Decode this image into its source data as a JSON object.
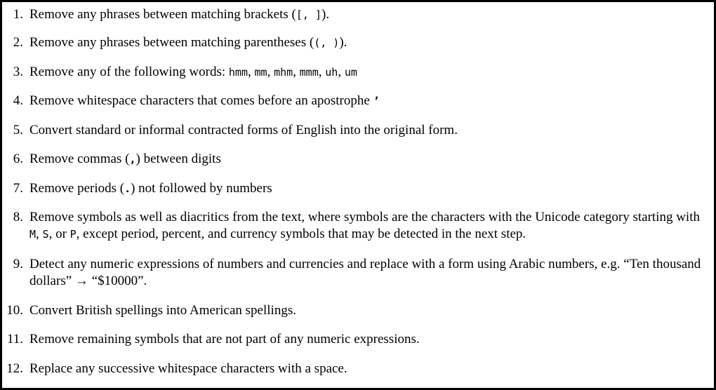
{
  "steps": [
    {
      "num": "1.",
      "segments": [
        {
          "t": "Remove any phrases between matching brackets ("
        },
        {
          "t": "[, ]",
          "mono": true
        },
        {
          "t": ")."
        }
      ]
    },
    {
      "num": "2.",
      "segments": [
        {
          "t": "Remove any phrases between matching parentheses ("
        },
        {
          "t": "(, )",
          "mono": true
        },
        {
          "t": ")."
        }
      ]
    },
    {
      "num": "3.",
      "segments": [
        {
          "t": "Remove any of the following words: "
        },
        {
          "t": "hmm",
          "mono": true
        },
        {
          "t": ", "
        },
        {
          "t": "mm",
          "mono": true
        },
        {
          "t": ", "
        },
        {
          "t": "mhm",
          "mono": true
        },
        {
          "t": ", "
        },
        {
          "t": "mmm",
          "mono": true
        },
        {
          "t": ", "
        },
        {
          "t": "uh",
          "mono": true
        },
        {
          "t": ", "
        },
        {
          "t": "um",
          "mono": true
        }
      ]
    },
    {
      "num": "4.",
      "segments": [
        {
          "t": "Remove whitespace characters that comes before an apostrophe "
        },
        {
          "t": "’",
          "mono": true,
          "bold": true
        }
      ]
    },
    {
      "num": "5.",
      "segments": [
        {
          "t": "Convert standard or informal contracted forms of English into the original form."
        }
      ]
    },
    {
      "num": "6.",
      "segments": [
        {
          "t": "Remove commas ("
        },
        {
          "t": ",",
          "mono": true,
          "bold": true
        },
        {
          "t": ") between digits"
        }
      ]
    },
    {
      "num": "7.",
      "segments": [
        {
          "t": "Remove periods ("
        },
        {
          "t": ".",
          "mono": true,
          "bold": true
        },
        {
          "t": ") not followed by numbers"
        }
      ]
    },
    {
      "num": "8.",
      "segments": [
        {
          "t": "Remove symbols as well as diacritics from the text, where symbols are the characters with the Unicode category starting with "
        },
        {
          "t": "M",
          "mono": true
        },
        {
          "t": ", "
        },
        {
          "t": "S",
          "mono": true
        },
        {
          "t": ", or "
        },
        {
          "t": "P",
          "mono": true
        },
        {
          "t": ", except period, percent, and currency symbols that may be detected in the next step."
        }
      ]
    },
    {
      "num": "9.",
      "segments": [
        {
          "t": "Detect any numeric expressions of numbers and currencies and replace with a form using Arabic numbers, e.g. “Ten thousand dollars” → “$10000”."
        }
      ]
    },
    {
      "num": "10.",
      "segments": [
        {
          "t": "Convert British spellings into American spellings."
        }
      ]
    },
    {
      "num": "11.",
      "segments": [
        {
          "t": "Remove remaining symbols that are not part of any numeric expressions."
        }
      ]
    },
    {
      "num": "12.",
      "segments": [
        {
          "t": "Replace any successive whitespace characters with a space."
        }
      ]
    }
  ]
}
